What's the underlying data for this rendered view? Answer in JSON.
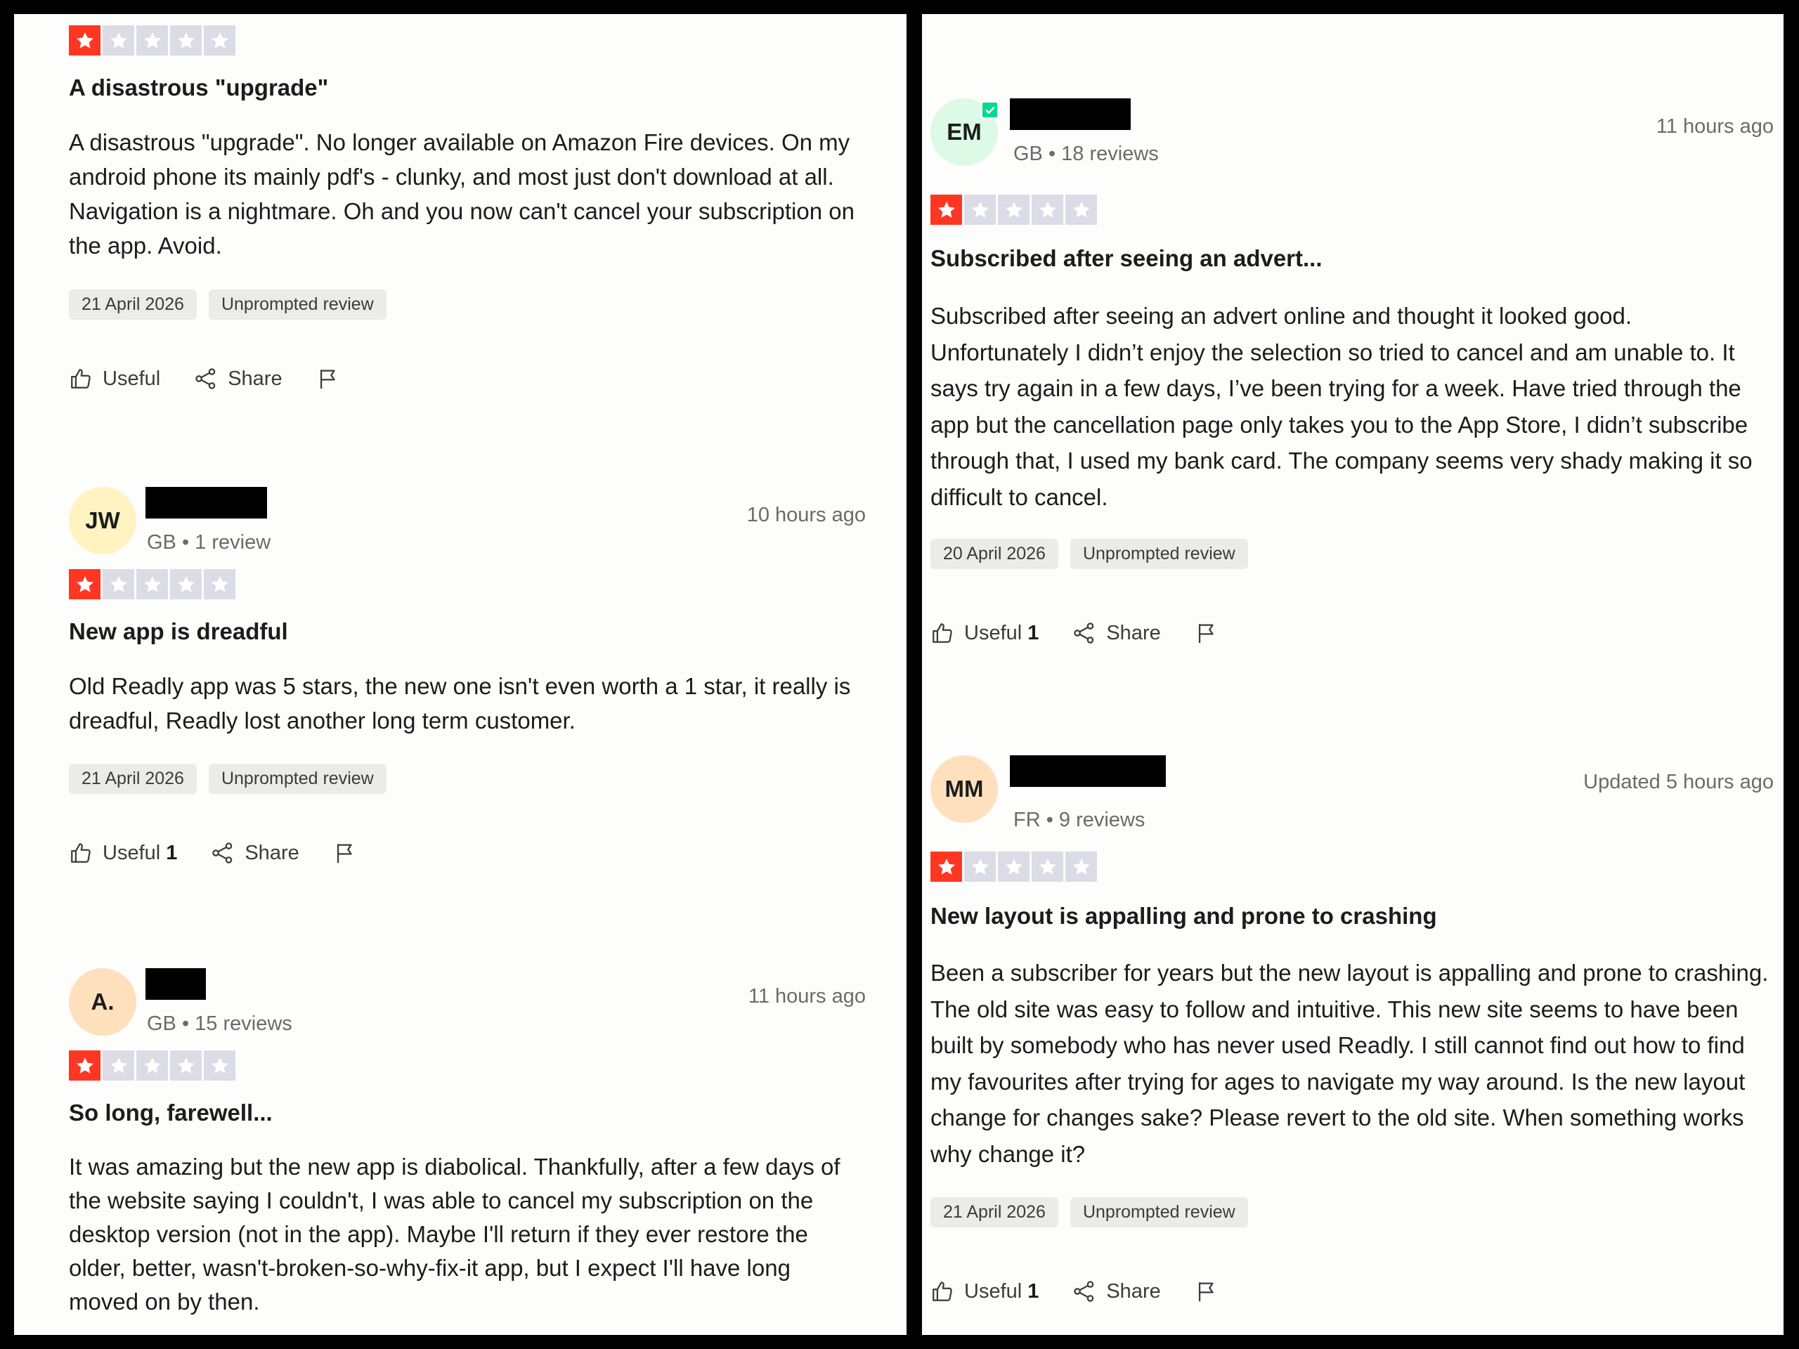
{
  "colors": {
    "star_on": "#ff3722",
    "star_off": "#dcdce6",
    "verified": "#04da8d",
    "tag_bg": "#ebebe7"
  },
  "left_reviews": [
    {
      "rating": 1,
      "title": "A disastrous \"upgrade\"",
      "body": "A disastrous \"upgrade\". No longer available on Amazon Fire devices. On my android phone its mainly pdf's - clunky, and most just don't download at all. Navigation is a nightmare. Oh and you now can't cancel your subscription on the app. Avoid.",
      "experience_date": "21 April 2026",
      "tag": "Unprompted review",
      "useful_label": "Useful",
      "useful_count": "",
      "share_label": "Share"
    },
    {
      "initials": "JW",
      "meta": "GB • 1 review",
      "posted": "10 hours ago",
      "rating": 1,
      "title": "New app is dreadful",
      "body": "Old Readly app was 5 stars, the new one isn't even worth a 1 star, it really is dreadful, Readly lost another long term customer.",
      "experience_date": "21 April 2026",
      "tag": "Unprompted review",
      "useful_label": "Useful",
      "useful_count": "1",
      "share_label": "Share"
    },
    {
      "initials": "A.",
      "meta": "GB • 15 reviews",
      "posted": "11 hours ago",
      "rating": 1,
      "title": "So long, farewell...",
      "body": "It was amazing but the new app is diabolical. Thankfully, after a few days of the website saying I couldn't, I was able to cancel my subscription on the desktop version (not in the app). Maybe I'll return if they ever restore the older, better, wasn't-broken-so-why-fix-it app, but I expect I'll have long moved on by then."
    }
  ],
  "right_reviews": [
    {
      "initials": "EM",
      "verified": true,
      "meta": "GB • 18 reviews",
      "posted": "11 hours ago",
      "rating": 1,
      "title": "Subscribed after seeing an advert...",
      "body": "Subscribed after seeing an advert online and thought it looked good. Unfortunately I didn’t enjoy the selection so tried to cancel and am unable to. It says try again in a few days, I’ve been trying for a week. Have tried through the app but the cancellation page only takes you to the App Store, I didn’t subscribe through that, I used my bank card. The company seems very shady making it so difficult to cancel.",
      "experience_date": "20 April 2026",
      "tag": "Unprompted review",
      "useful_label": "Useful",
      "useful_count": "1",
      "share_label": "Share"
    },
    {
      "initials": "MM",
      "meta": "FR • 9 reviews",
      "posted": "Updated 5 hours ago",
      "rating": 1,
      "title": "New layout is appalling and prone to crashing",
      "body": "Been a subscriber for years but the new layout is appalling and prone to crashing. The old site was easy to follow and intuitive. This new site seems to have been built by somebody who has never used Readly. I still cannot find out how to find my favourites after trying for ages to navigate my way around. Is the new layout change for changes sake? Please revert to the old site. When something works why change it?",
      "experience_date": "21 April 2026",
      "tag": "Unprompted review",
      "useful_label": "Useful",
      "useful_count": "1",
      "share_label": "Share"
    }
  ]
}
